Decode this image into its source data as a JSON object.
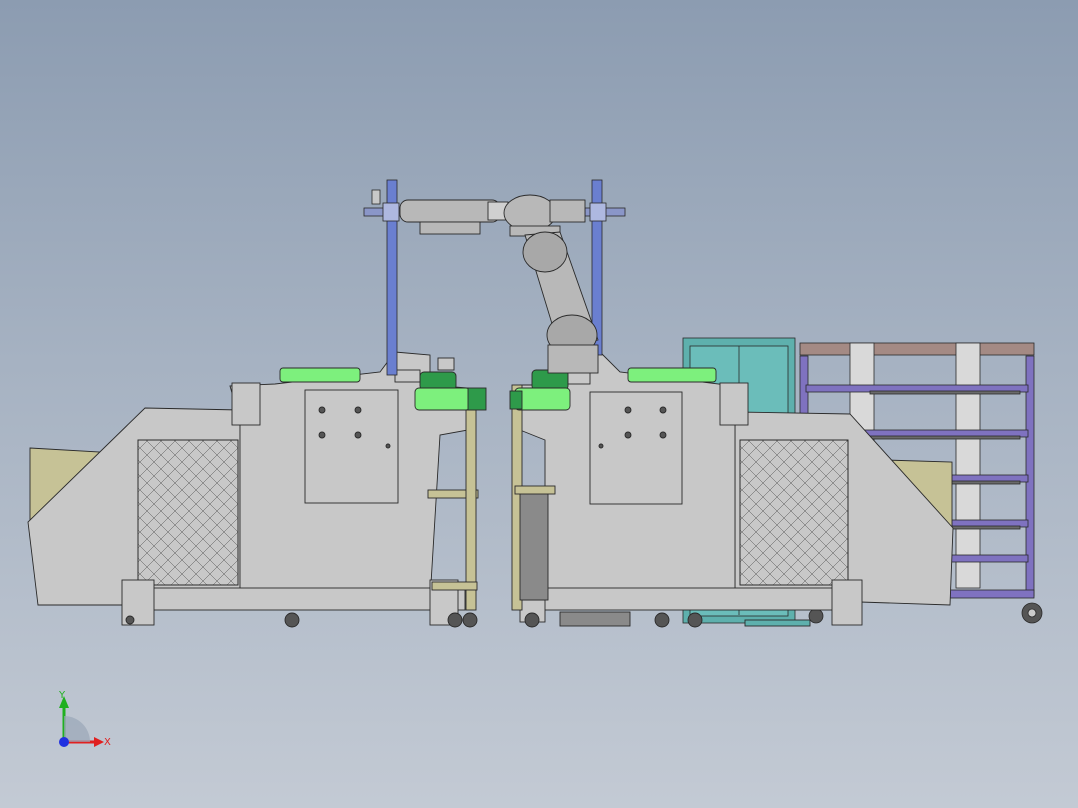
{
  "viewport": {
    "background_top": "#8c9cb1",
    "background_bottom": "#c3cad4"
  },
  "colors": {
    "machine_body": "#c8c8c8",
    "outline": "#2a2a2a",
    "green_part": "#7df07d",
    "dark_green_part": "#2e9a4a",
    "teal_cabinet": "#5eb0ad",
    "purple_rack": "#7f72c0",
    "olive_panel": "#c6c296",
    "column_blue": "#6a7fd0",
    "robot_arm": "#b8b8b8"
  },
  "triad": {
    "x_label": "X",
    "y_label": "Y",
    "x_color": "#e02020",
    "y_color": "#20b020",
    "z_color": "#2030e0"
  }
}
